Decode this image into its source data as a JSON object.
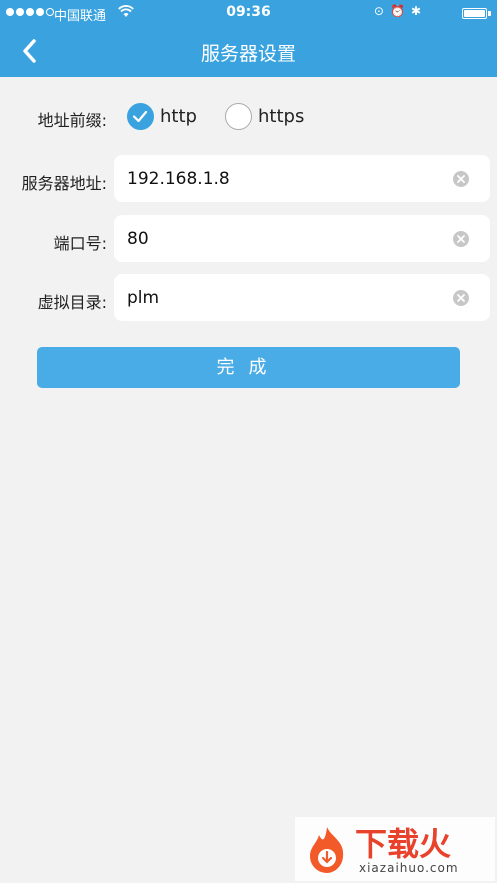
{
  "status_bar": {
    "carrier": "中国联通",
    "time": "09:36"
  },
  "nav": {
    "title": "服务器设置"
  },
  "form": {
    "prefix_label": "地址前缀:",
    "prefix_options": [
      {
        "label": "http",
        "checked": true
      },
      {
        "label": "https",
        "checked": false
      }
    ],
    "server_label": "服务器地址:",
    "server_value": "192.168.1.8",
    "port_label": "端口号:",
    "port_value": "80",
    "dir_label": "虚拟目录:",
    "dir_value": "plm",
    "submit_label": "完成"
  },
  "watermark": {
    "brand": "下载火",
    "domain": "xiazaihuo.com"
  },
  "colors": {
    "accent": "#3aa3df",
    "button": "#4aace6",
    "background": "#f2f2f2"
  }
}
